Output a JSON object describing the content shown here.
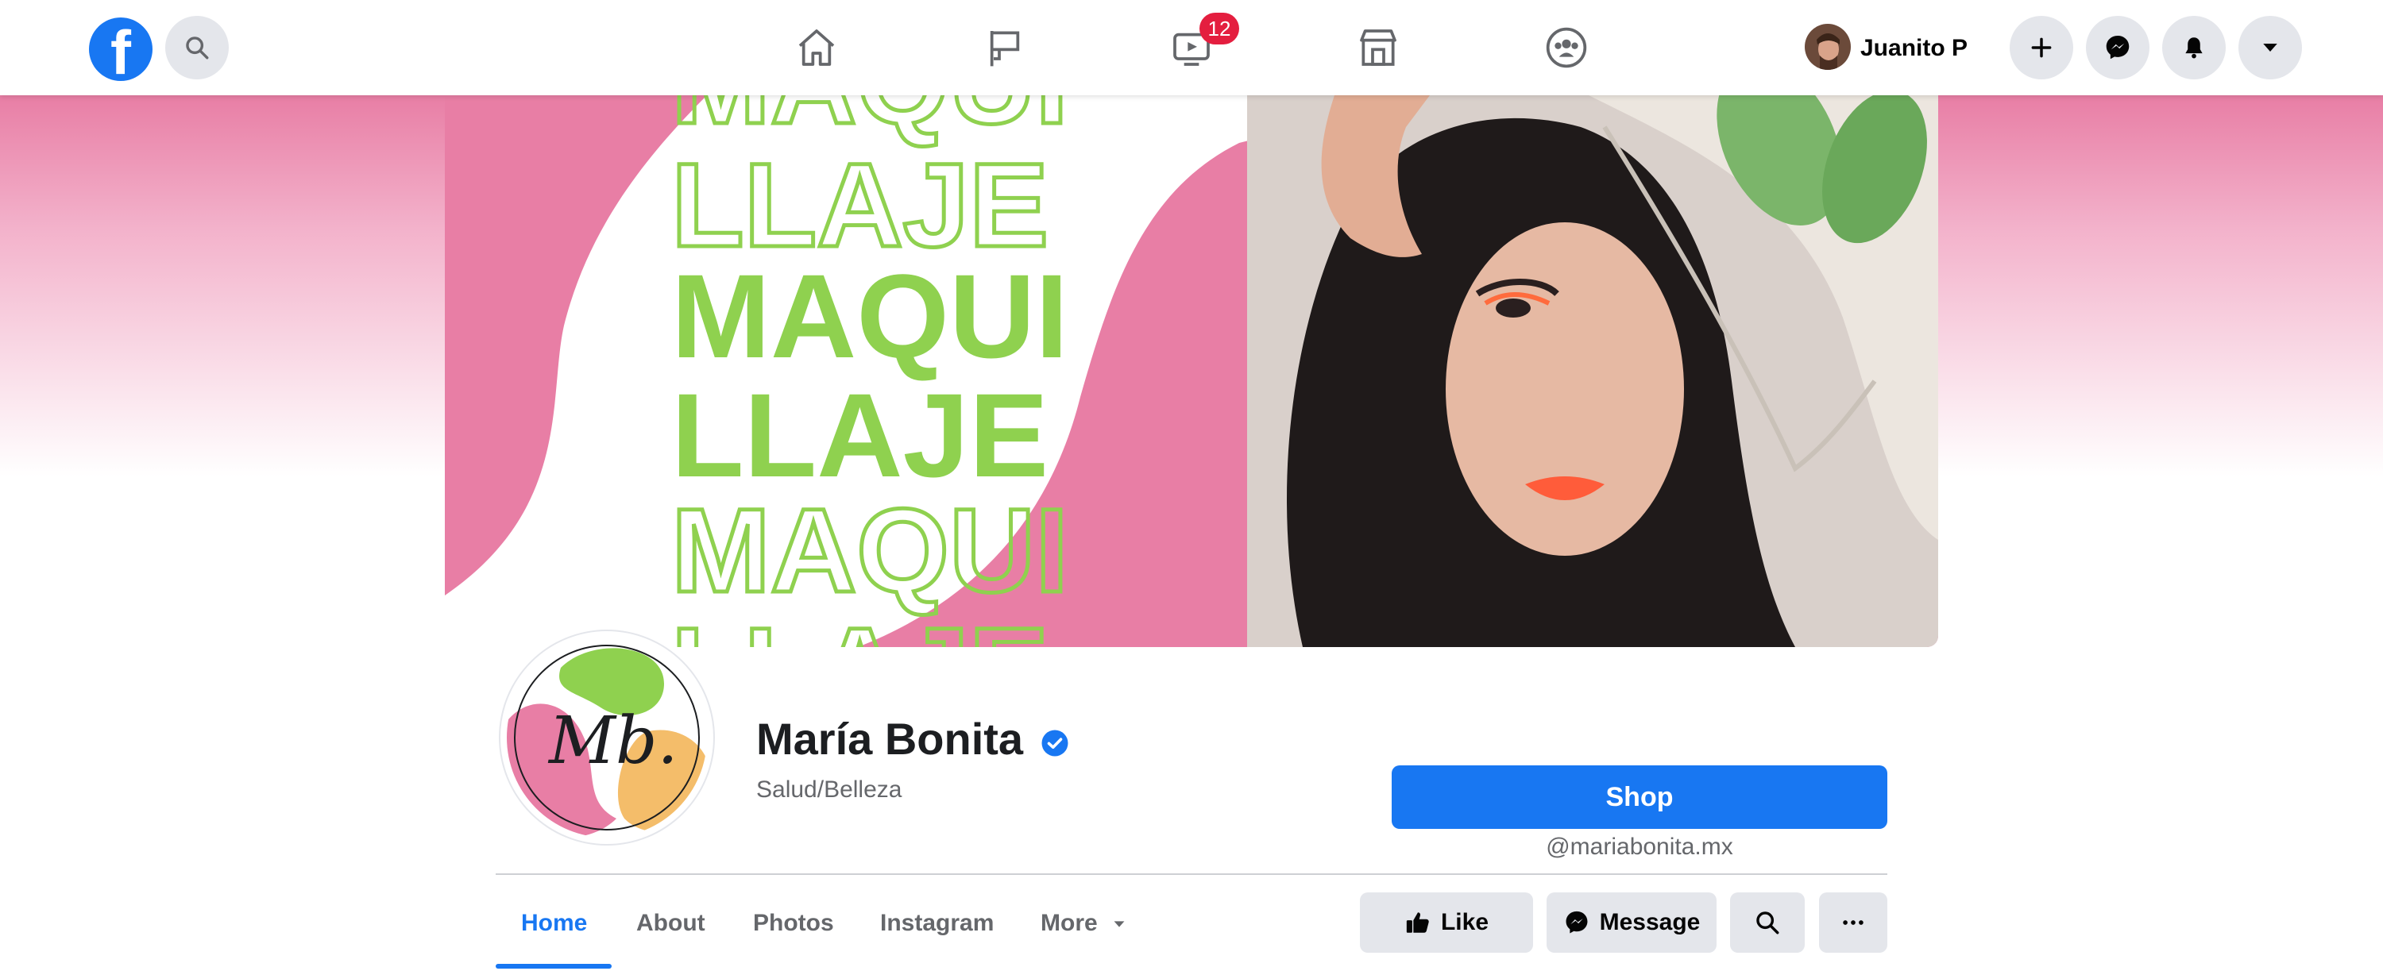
{
  "topbar": {
    "user_name": "Juanito P",
    "watch_badge": "12",
    "icons": [
      "facebook-logo-icon",
      "search-icon",
      "home-icon",
      "flag-icon",
      "watch-icon",
      "marketplace-icon",
      "groups-icon",
      "plus-icon",
      "messenger-icon",
      "bell-icon",
      "caret-down-icon"
    ]
  },
  "cover": {
    "text_lines": [
      "MAQUI",
      "LLAJE",
      "MAQUI",
      "LLAJE",
      "MAQUI",
      "LLAJE"
    ],
    "colors": {
      "pink": "#e87ea5",
      "green": "#8fd14f"
    }
  },
  "profile": {
    "monogram": "Mb.",
    "name": "María Bonita",
    "category": "Salud/Belleza"
  },
  "cta": {
    "shop_label": "Shop",
    "handle": "@mariabonita.mx"
  },
  "tabs": [
    {
      "label": "Home",
      "active": true
    },
    {
      "label": "About"
    },
    {
      "label": "Photos"
    },
    {
      "label": "Instagram"
    },
    {
      "label": "More"
    }
  ],
  "actions": {
    "like_label": "Like",
    "message_label": "Message"
  },
  "colors": {
    "brand_blue": "#1877f2",
    "badge_red": "#e41e3f"
  }
}
